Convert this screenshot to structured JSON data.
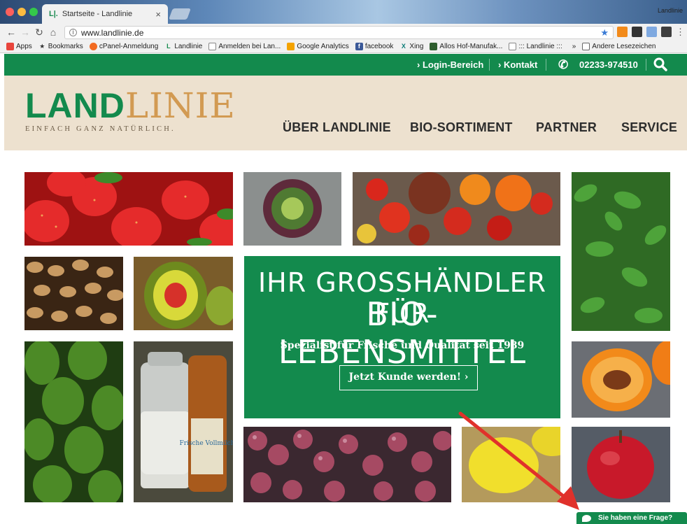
{
  "browser": {
    "tab_title": "Startseite - Landlinie",
    "tab_favicon": "L|.",
    "tab_close": "×",
    "window_user": "Landlinie",
    "url": "www.landlinie.de",
    "bookmarks": [
      {
        "label": "Apps",
        "icon": "apps-grid-icon",
        "color": "#e8453c"
      },
      {
        "label": "Bookmarks",
        "icon": "star-icon",
        "color": "#333333"
      },
      {
        "label": "cPanel-Anmeldung",
        "icon": "cpanel-icon",
        "color": "#f26b21"
      },
      {
        "label": "Landlinie",
        "icon": "landlinie-icon",
        "color": "#138a4d"
      },
      {
        "label": "Anmelden bei Lan...",
        "icon": "page-icon",
        "color": "#888888"
      },
      {
        "label": "Google Analytics",
        "icon": "analytics-icon",
        "color": "#f4a300"
      },
      {
        "label": "facebook",
        "icon": "facebook-icon",
        "color": "#3b5998"
      },
      {
        "label": "Xing",
        "icon": "xing-icon",
        "color": "#0a7b76"
      },
      {
        "label": "Allos Hof-Manufak...",
        "icon": "allos-icon",
        "color": "#2e5d2e"
      },
      {
        "label": "::: Landlinie :::",
        "icon": "page-icon",
        "color": "#888888"
      }
    ],
    "bookmarks_overflow": "»",
    "other_bookmarks": "Andere Lesezeichen"
  },
  "site": {
    "topbar": {
      "login": "› Login-Bereich",
      "contact": "› Kontakt",
      "phone": "02233-974510"
    },
    "logo": {
      "part1": "LAND",
      "part2": "LINIE",
      "tagline": "EINFACH GANZ NATÜRLICH."
    },
    "nav": [
      "ÜBER LANDLINIE",
      "BIO-SORTIMENT",
      "PARTNER",
      "SERVICE"
    ],
    "hero": {
      "line1": "IHR GROSSHÄNDLER FÜR",
      "line2": "BIO-LEBENSMITTEL",
      "subtitle": "Spezialist für Frische und Qualität seit 1989",
      "cta": "Jetzt Kunde werden!  ›"
    },
    "chat": "Sie haben eine Frage?",
    "product_milk_label": "Frische Vollmilch",
    "colors": {
      "brand_green": "#138a4d",
      "header_beige": "#ede1cf",
      "logo_gold": "#d29a52",
      "arrow_red": "#e0312b"
    }
  }
}
